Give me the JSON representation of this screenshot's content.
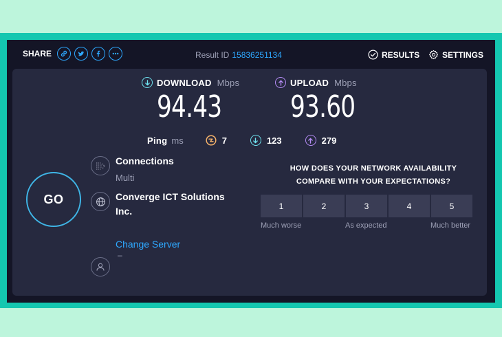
{
  "share": {
    "label": "SHARE"
  },
  "result": {
    "label": "Result ID",
    "id": "15836251134"
  },
  "nav": {
    "results": "RESULTS",
    "settings": "SETTINGS"
  },
  "download": {
    "label": "DOWNLOAD",
    "unit": "Mbps",
    "value": "94.43"
  },
  "upload": {
    "label": "UPLOAD",
    "unit": "Mbps",
    "value": "93.60"
  },
  "ping": {
    "label": "Ping",
    "unit": "ms",
    "idle": "7",
    "download": "123",
    "upload": "279"
  },
  "go": {
    "label": "GO"
  },
  "connections": {
    "title": "Connections",
    "value": "Multi"
  },
  "server": {
    "name_line1": "Converge ICT Solutions",
    "name_line2": "Inc.",
    "change_label": "Change Server"
  },
  "user": {
    "value": "–"
  },
  "survey": {
    "question_line1": "HOW DOES YOUR NETWORK AVAILABILITY",
    "question_line2": "COMPARE WITH YOUR EXPECTATIONS?",
    "options": [
      "1",
      "2",
      "3",
      "4",
      "5"
    ],
    "low_label": "Much worse",
    "mid_label": "As expected",
    "high_label": "Much better"
  },
  "colors": {
    "accent_blue": "#2ea8ff",
    "download_cyan": "#6fe3f0",
    "upload_purple": "#b58cf5",
    "ping_orange": "#f5b26b",
    "background": "#141526",
    "panel": "#26293f"
  }
}
